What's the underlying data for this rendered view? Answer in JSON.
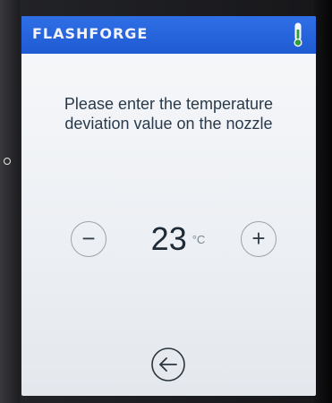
{
  "header": {
    "brand": "FLASHFORGE",
    "icon": "thermometer-icon",
    "color": "#2363d8"
  },
  "main": {
    "prompt": "Please enter the temperature deviation value on the nozzle",
    "value": "23",
    "unit": "°C",
    "decrement_label": "−",
    "increment_label": "+"
  },
  "footer": {
    "back_icon": "back-arrow-icon"
  }
}
